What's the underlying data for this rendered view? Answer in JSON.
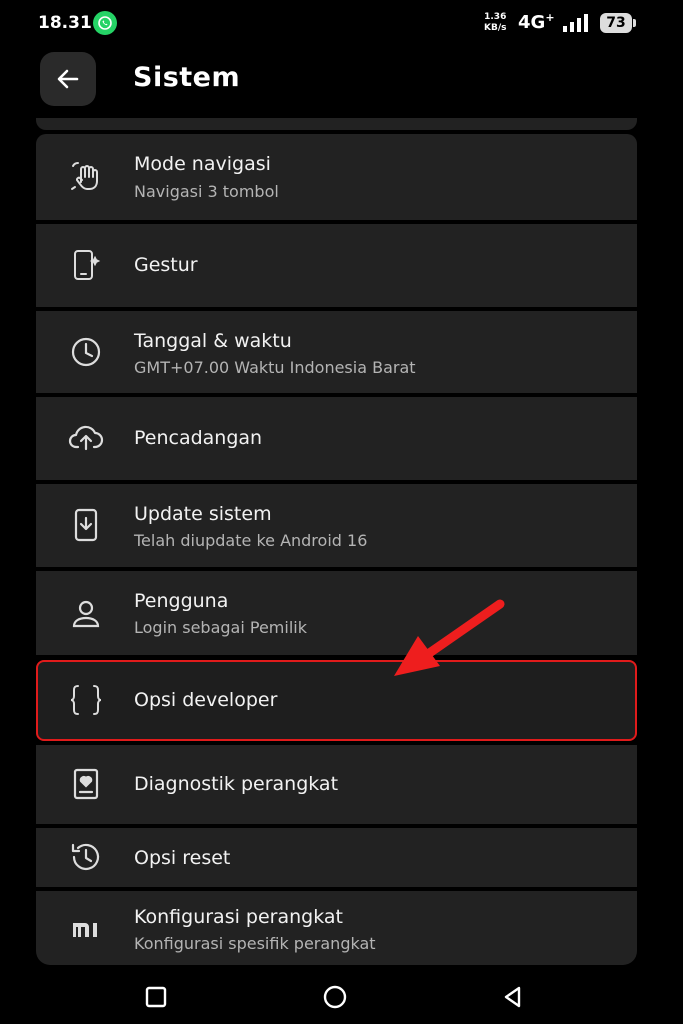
{
  "status": {
    "time": "18.31",
    "speed_value": "1.36",
    "speed_unit": "KB/s",
    "network": "4G",
    "network_sup": "+",
    "battery": "73"
  },
  "header": {
    "title": "Sistem"
  },
  "items": [
    {
      "title": "Mode navigasi",
      "subtitle": "Navigasi 3 tombol",
      "icon": "gesture-hand-icon"
    },
    {
      "title": "Gestur",
      "subtitle": "",
      "icon": "phone-sparkle-icon"
    },
    {
      "title": "Tanggal & waktu",
      "subtitle": "GMT+07.00 Waktu Indonesia Barat",
      "icon": "clock-icon"
    },
    {
      "title": "Pencadangan",
      "subtitle": "",
      "icon": "cloud-upload-icon"
    },
    {
      "title": "Update sistem",
      "subtitle": "Telah diupdate ke Android 16",
      "icon": "system-update-icon"
    },
    {
      "title": "Pengguna",
      "subtitle": "Login sebagai Pemilik",
      "icon": "person-icon"
    },
    {
      "title": "Opsi developer",
      "subtitle": "",
      "icon": "braces-icon"
    },
    {
      "title": "Diagnostik perangkat",
      "subtitle": "",
      "icon": "diagnostics-icon"
    },
    {
      "title": "Opsi reset",
      "subtitle": "",
      "icon": "history-icon"
    },
    {
      "title": "Konfigurasi perangkat",
      "subtitle": "Konfigurasi spesifik perangkat",
      "icon": "mi-logo-icon"
    }
  ],
  "colors": {
    "highlight": "#e01b1b",
    "card": "#222222",
    "whatsapp": "#25d366"
  }
}
